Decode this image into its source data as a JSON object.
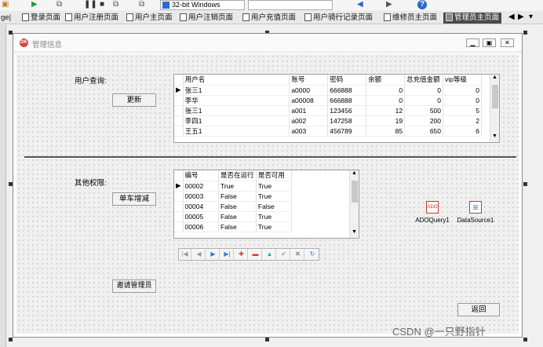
{
  "toolbar": {
    "platform_select": "32-bit Windows",
    "help_icon": "?"
  },
  "tabs": [
    {
      "label": "ge|",
      "active": false
    },
    {
      "label": "登录页面",
      "active": false
    },
    {
      "label": "用户注册页面",
      "active": false
    },
    {
      "label": "用户主页面",
      "active": false
    },
    {
      "label": "用户注销页面",
      "active": false
    },
    {
      "label": "用户充值页面",
      "active": false
    },
    {
      "label": "用户骑行记录页面",
      "active": false
    },
    {
      "label": "维修员主页面",
      "active": false
    },
    {
      "label": "管理员主页面",
      "active": true
    }
  ],
  "form": {
    "title": "管理信息",
    "user_query_label": "用户查询:",
    "refresh_button": "更新",
    "other_perm_label": "其他权限:",
    "bike_button": "单车增减",
    "invite_button": "邀请管理员",
    "back_button": "返回"
  },
  "users_grid": {
    "columns": [
      "用户名",
      "账号",
      "密码",
      "余额",
      "总充值金额",
      "vip等级"
    ],
    "rows": [
      [
        "张三1",
        "a0000",
        "666888",
        "0",
        "0",
        "0"
      ],
      [
        "李华",
        "a00008",
        "666888",
        "0",
        "0",
        "0"
      ],
      [
        "张三1",
        "a001",
        "123456",
        "12",
        "500",
        "5"
      ],
      [
        "李四1",
        "a002",
        "147258",
        "19",
        "200",
        "2"
      ],
      [
        "王五1",
        "a003",
        "456789",
        "85",
        "650",
        "6"
      ]
    ]
  },
  "bikes_grid": {
    "columns": [
      "编号",
      "是否在运行",
      "是否可用"
    ],
    "rows": [
      [
        "00002",
        "True",
        "True"
      ],
      [
        "00003",
        "False",
        "True"
      ],
      [
        "00004",
        "False",
        "False"
      ],
      [
        "00005",
        "False",
        "True"
      ],
      [
        "00006",
        "False",
        "True"
      ]
    ]
  },
  "components": {
    "adoquery": "ADOQuery1",
    "datasource": "DataSource1"
  },
  "watermark": "CSDN @一只野指针",
  "colors": {
    "active_tab": "#4a4a4a",
    "nav_blue": "#2e7bd6",
    "nav_red": "#d83a2a",
    "nav_teal": "#2aa9a0",
    "form_icon": "#e04040"
  }
}
